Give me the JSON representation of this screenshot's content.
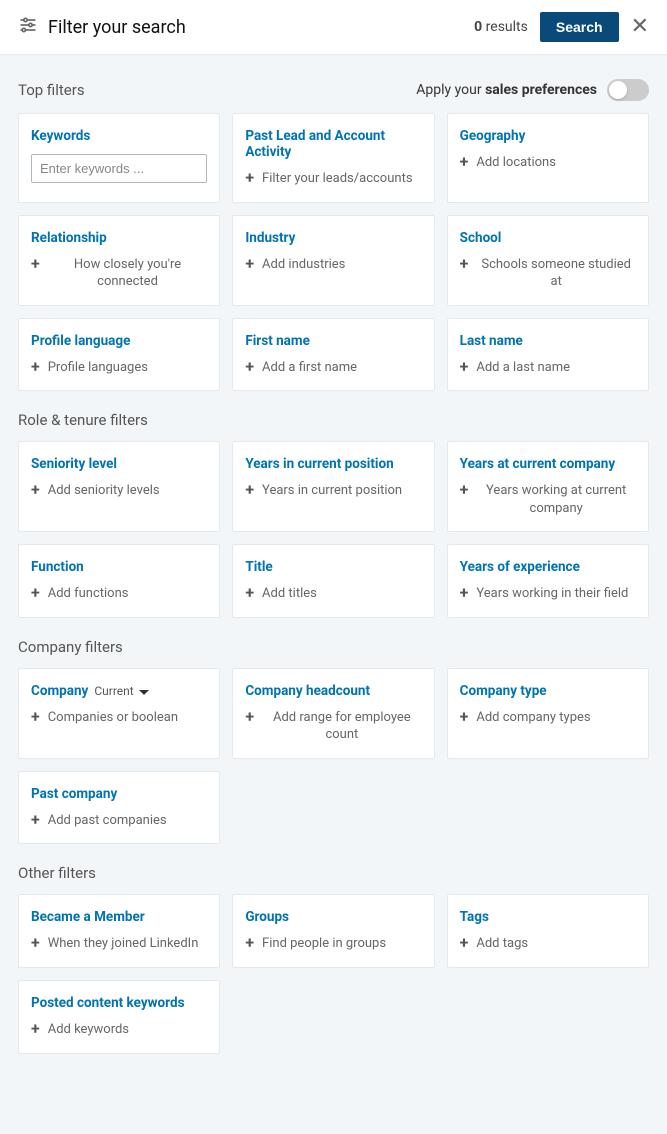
{
  "header": {
    "title": "Filter your search",
    "results_value": "0",
    "results_word": "results",
    "search_button": "Search"
  },
  "prefs": {
    "label_prefix": "Apply your ",
    "label_bold": "sales preferences"
  },
  "sections": {
    "top": "Top filters",
    "role": "Role & tenure filters",
    "company": "Company filters",
    "other": "Other filters"
  },
  "filters": {
    "keywords": {
      "title": "Keywords",
      "placeholder": "Enter keywords ..."
    },
    "past_activity": {
      "title": "Past Lead and Account Activity",
      "action": "Filter your leads/accounts"
    },
    "geography": {
      "title": "Geography",
      "action": "Add locations"
    },
    "relationship": {
      "title": "Relationship",
      "action": "How closely you're connected"
    },
    "industry": {
      "title": "Industry",
      "action": "Add industries"
    },
    "school": {
      "title": "School",
      "action": "Schools someone studied at"
    },
    "profile_language": {
      "title": "Profile language",
      "action": "Profile languages"
    },
    "first_name": {
      "title": "First name",
      "action": "Add a first name"
    },
    "last_name": {
      "title": "Last name",
      "action": "Add a last name"
    },
    "seniority": {
      "title": "Seniority level",
      "action": "Add seniority levels"
    },
    "years_position": {
      "title": "Years in current position",
      "action": "Years in current position"
    },
    "years_company": {
      "title": "Years at current company",
      "action": "Years working at current company"
    },
    "function": {
      "title": "Function",
      "action": "Add functions"
    },
    "title_filter": {
      "title": "Title",
      "action": "Add titles"
    },
    "years_experience": {
      "title": "Years of experience",
      "action": "Years working in their field"
    },
    "company": {
      "title": "Company",
      "sub": "Current",
      "action": "Companies or boolean"
    },
    "headcount": {
      "title": "Company headcount",
      "action": "Add range for employee count"
    },
    "company_type": {
      "title": "Company type",
      "action": "Add company types"
    },
    "past_company": {
      "title": "Past company",
      "action": "Add past companies"
    },
    "became_member": {
      "title": "Became a Member",
      "action": "When they joined LinkedIn"
    },
    "groups": {
      "title": "Groups",
      "action": "Find people in groups"
    },
    "tags": {
      "title": "Tags",
      "action": "Add tags"
    },
    "posted_keywords": {
      "title": "Posted content keywords",
      "action": "Add keywords"
    }
  }
}
